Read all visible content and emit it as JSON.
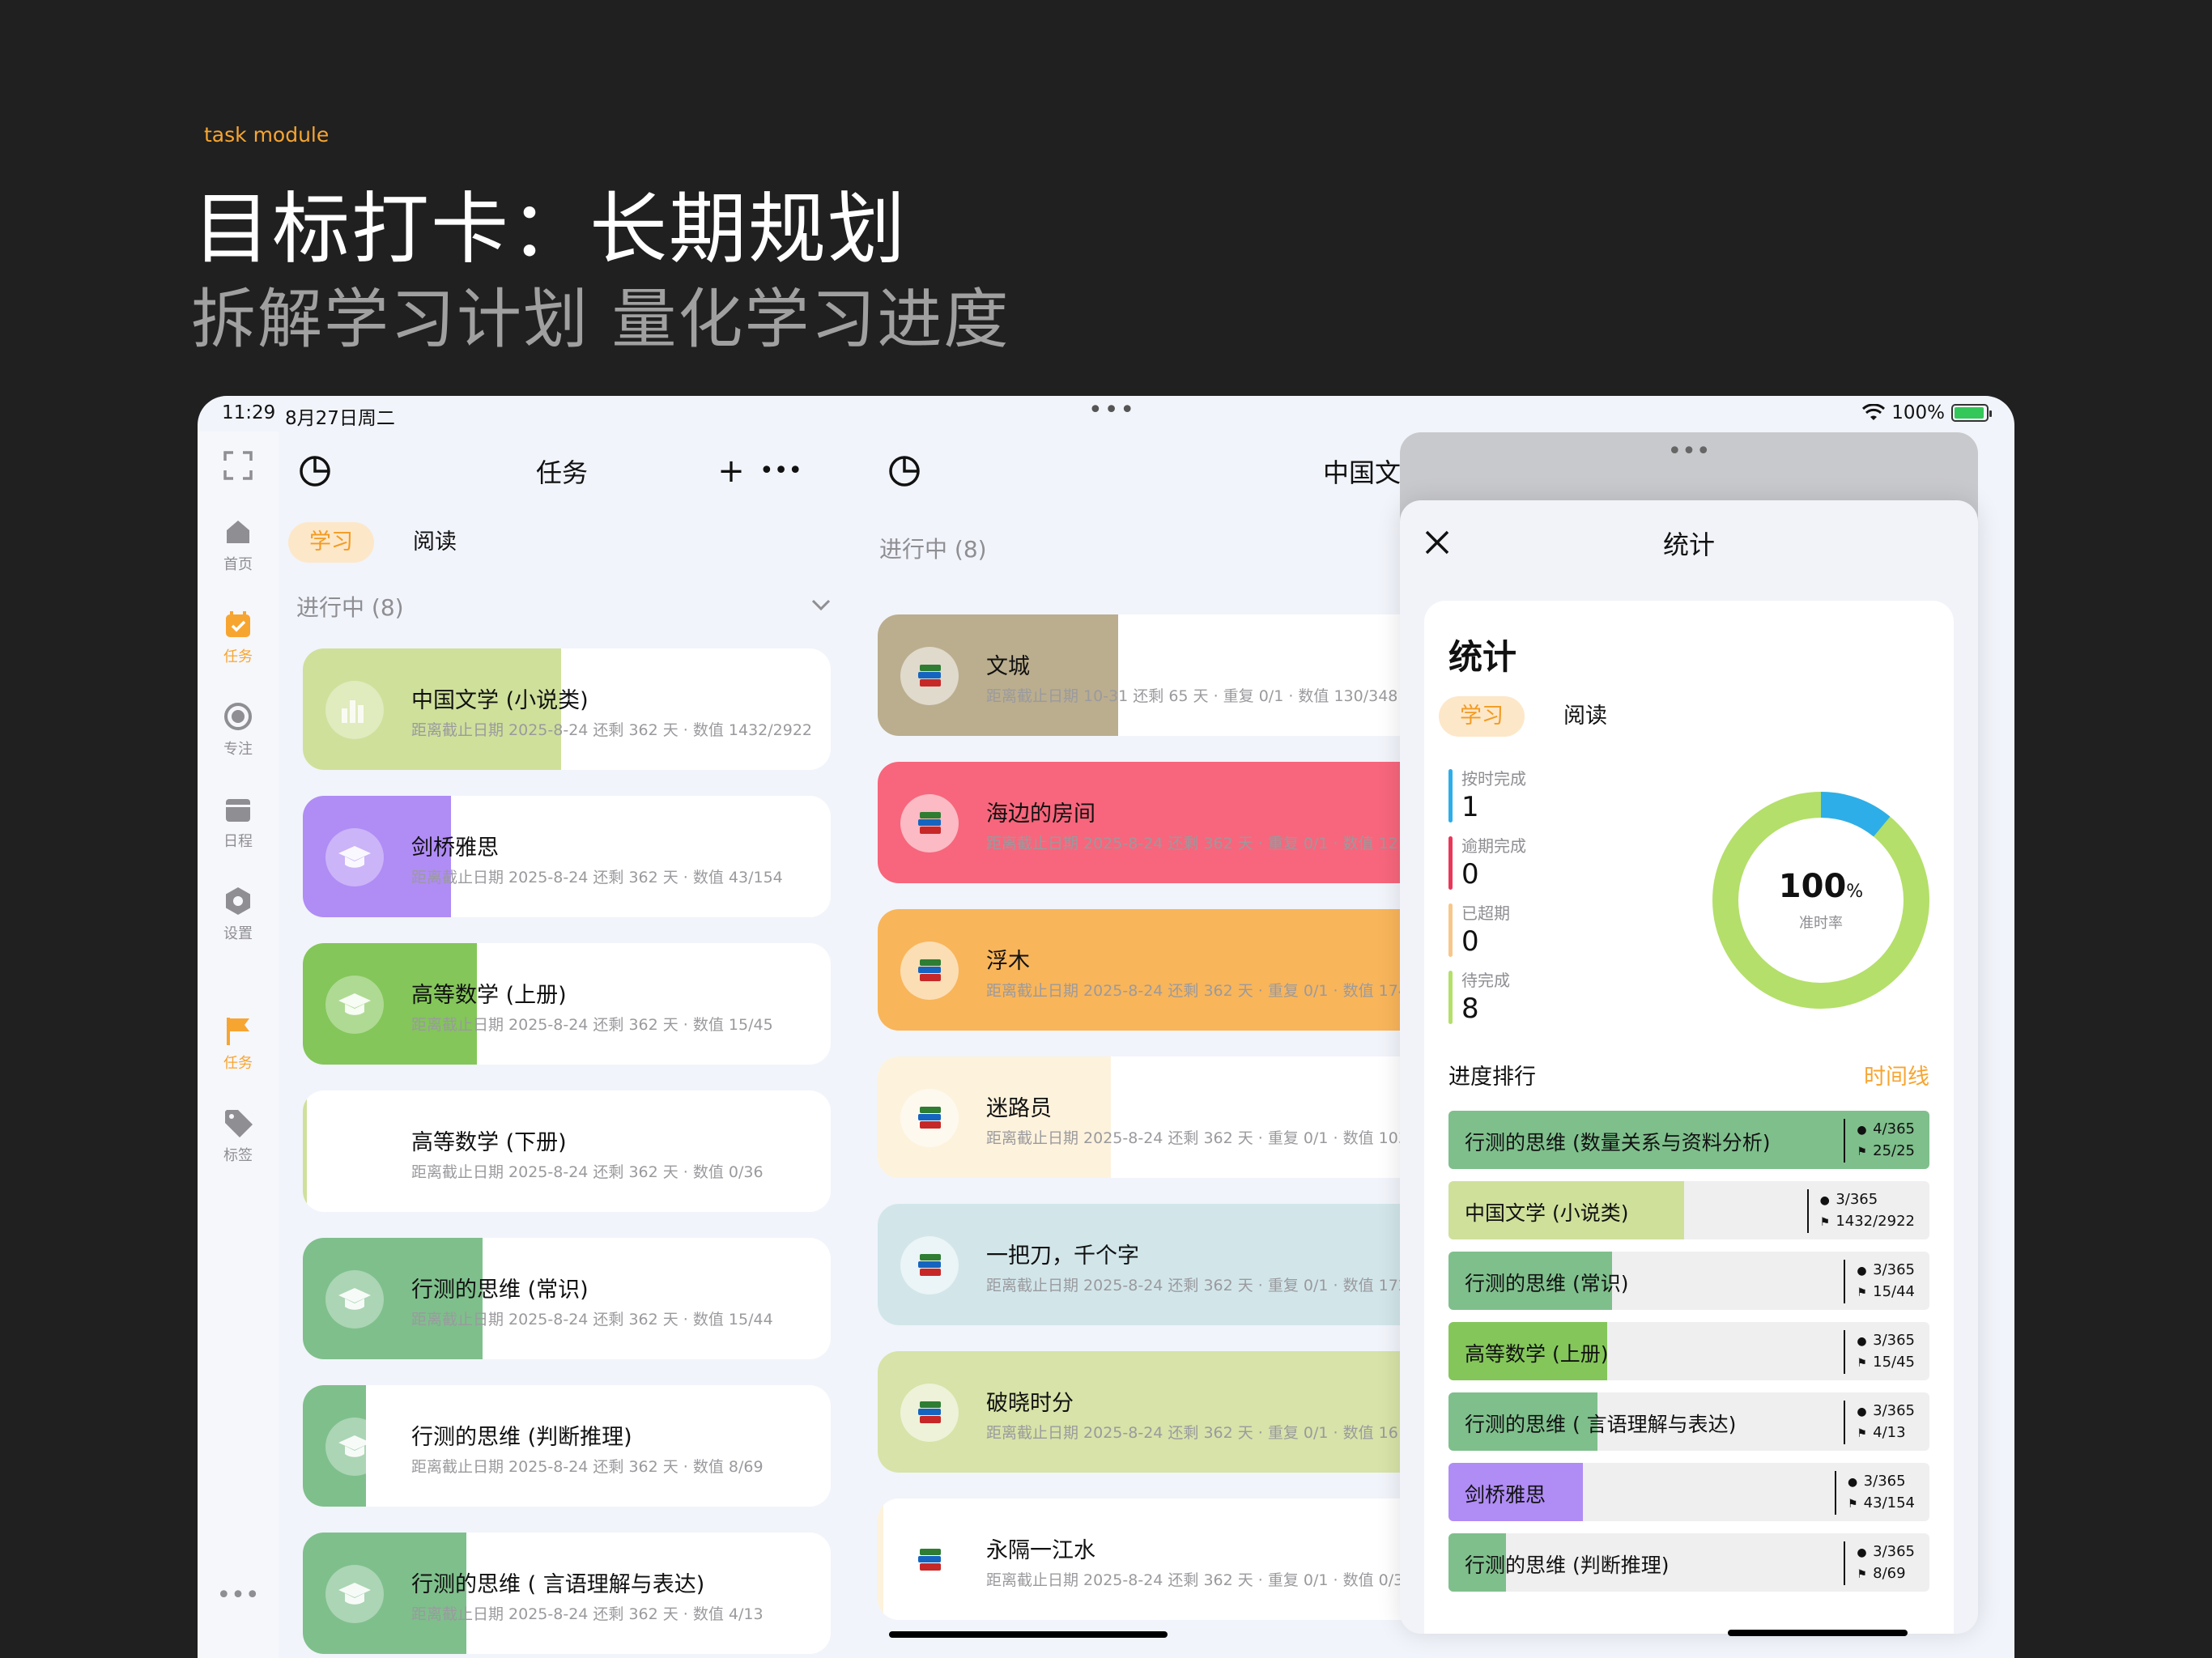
{
  "promo": {
    "tag": "task module",
    "title": "目标打卡：长期规划",
    "subtitle": "拆解学习计划 量化学习进度"
  },
  "status": {
    "time": "11:29",
    "date": "8月27日周二",
    "battery": "100%"
  },
  "rail": [
    {
      "label": "",
      "icon": "fullscreen-icon"
    },
    {
      "label": "首页",
      "icon": "home-icon"
    },
    {
      "label": "任务",
      "icon": "task-calendar-icon",
      "active": true
    },
    {
      "label": "专注",
      "icon": "focus-circle-icon"
    },
    {
      "label": "日程",
      "icon": "schedule-icon"
    },
    {
      "label": "设置",
      "icon": "settings-icon"
    },
    {
      "label": "任务",
      "icon": "flag-icon",
      "active": true
    },
    {
      "label": "标签",
      "icon": "tag-icon"
    }
  ],
  "col1": {
    "title": "任务",
    "tabs": [
      "学习",
      "阅读"
    ],
    "section": "进行中 (8)",
    "tasks": [
      {
        "name": "中国文学 (小说类)",
        "meta": "距离截止日期 2025-8-24 还剩 362 天 · 数值 1432/2922",
        "progress": 0.49,
        "color": "#cfe09b"
      },
      {
        "name": "剑桥雅思",
        "meta": "距离截止日期 2025-8-24 还剩 362 天 · 数值 43/154",
        "progress": 0.28,
        "color": "#b08cf5"
      },
      {
        "name": "高等数学 (上册)",
        "meta": "距离截止日期 2025-8-24 还剩 362 天 · 数值 15/45",
        "progress": 0.33,
        "color": "#84c65a"
      },
      {
        "name": "高等数学 (下册)",
        "meta": "距离截止日期 2025-8-24 还剩 362 天 · 数值 0/36",
        "progress": 0.0,
        "color": "#cfe09b"
      },
      {
        "name": "行测的思维 (常识)",
        "meta": "距离截止日期 2025-8-24 还剩 362 天 · 数值 15/44",
        "progress": 0.34,
        "color": "#7fbf8c"
      },
      {
        "name": "行测的思维 (判断推理)",
        "meta": "距离截止日期 2025-8-24 还剩 362 天 · 数值 8/69",
        "progress": 0.12,
        "color": "#7fbf8c"
      },
      {
        "name": "行测的思维 ( 言语理解与表达)",
        "meta": "距离截止日期 2025-8-24 还剩 362 天 · 数值 4/13",
        "progress": 0.31,
        "color": "#7fbf8c"
      }
    ]
  },
  "col2": {
    "title": "中国文",
    "section": "进行中 (8)",
    "books": [
      {
        "name": "文城",
        "meta": "距离截止日期 10-31 还剩 65 天 · 重复 0/1 · 数值 130/348",
        "progress": 0.33,
        "color": "#bbae8e"
      },
      {
        "name": "海边的房间",
        "meta": "距离截止日期 2025-8-24 还剩 362 天 · 重复 0/1 · 数值 121/2",
        "progress": 1.0,
        "color": "#f7667c"
      },
      {
        "name": "浮木",
        "meta": "距离截止日期 2025-8-24 还剩 362 天 · 重复 0/1 · 数值 174/2",
        "progress": 1.0,
        "color": "#f9b55a"
      },
      {
        "name": "迷路员",
        "meta": "距离截止日期 2025-8-24 还剩 362 天 · 重复 0/1 · 数值 103/2",
        "progress": 0.32,
        "color": "#fdf2dc"
      },
      {
        "name": "一把刀，千个字",
        "meta": "距离截止日期 2025-8-24 还剩 362 天 · 重复 0/1 · 数值 172/3",
        "progress": 1.0,
        "color": "#d2e6ea"
      },
      {
        "name": "破晓时分",
        "meta": "距离截止日期 2025-8-24 还剩 362 天 · 重复 0/1 · 数值 161/3",
        "progress": 1.0,
        "color": "#d7e3a8"
      },
      {
        "name": "永隔一江水",
        "meta": "距离截止日期 2025-8-24 还剩 362 天 · 重复 0/1 · 数值 0/324",
        "progress": 0.0,
        "color": "#fdf2dc"
      }
    ]
  },
  "stats": {
    "sheet_title": "统计",
    "card_title": "统计",
    "tabs": [
      "学习",
      "阅读"
    ],
    "kpis": [
      {
        "label": "按时完成",
        "value": "1",
        "color": "#2eaee8"
      },
      {
        "label": "逾期完成",
        "value": "0",
        "color": "#e9375a"
      },
      {
        "label": "已超期",
        "value": "0",
        "color": "#f7c78a"
      },
      {
        "label": "待完成",
        "value": "8",
        "color": "#b4df6a"
      }
    ],
    "donut": {
      "value": "100",
      "unit": "%",
      "label": "准时率",
      "ontime_fraction": 0.11,
      "colors": [
        "#2eaee8",
        "#b4df6a"
      ]
    },
    "rank_title": "进度排行",
    "rank_link": "时间线",
    "ranks": [
      {
        "name": "行测的思维 (数量关系与资料分析)",
        "days": "4/365",
        "value": "25/25",
        "progress": 1.0,
        "color": "#7fbf8c"
      },
      {
        "name": "中国文学 (小说类)",
        "days": "3/365",
        "value": "1432/2922",
        "progress": 0.49,
        "color": "#cfe09b"
      },
      {
        "name": "行测的思维 (常识)",
        "days": "3/365",
        "value": "15/44",
        "progress": 0.34,
        "color": "#7fbf8c"
      },
      {
        "name": "高等数学 (上册)",
        "days": "3/365",
        "value": "15/45",
        "progress": 0.33,
        "color": "#84c65a"
      },
      {
        "name": "行测的思维 ( 言语理解与表达)",
        "days": "3/365",
        "value": "4/13",
        "progress": 0.31,
        "color": "#7fbf8c"
      },
      {
        "name": "剑桥雅思",
        "days": "3/365",
        "value": "43/154",
        "progress": 0.28,
        "color": "#b08cf5"
      },
      {
        "name": "行测的思维 (判断推理)",
        "days": "3/365",
        "value": "8/69",
        "progress": 0.12,
        "color": "#7fbf8c"
      }
    ]
  }
}
